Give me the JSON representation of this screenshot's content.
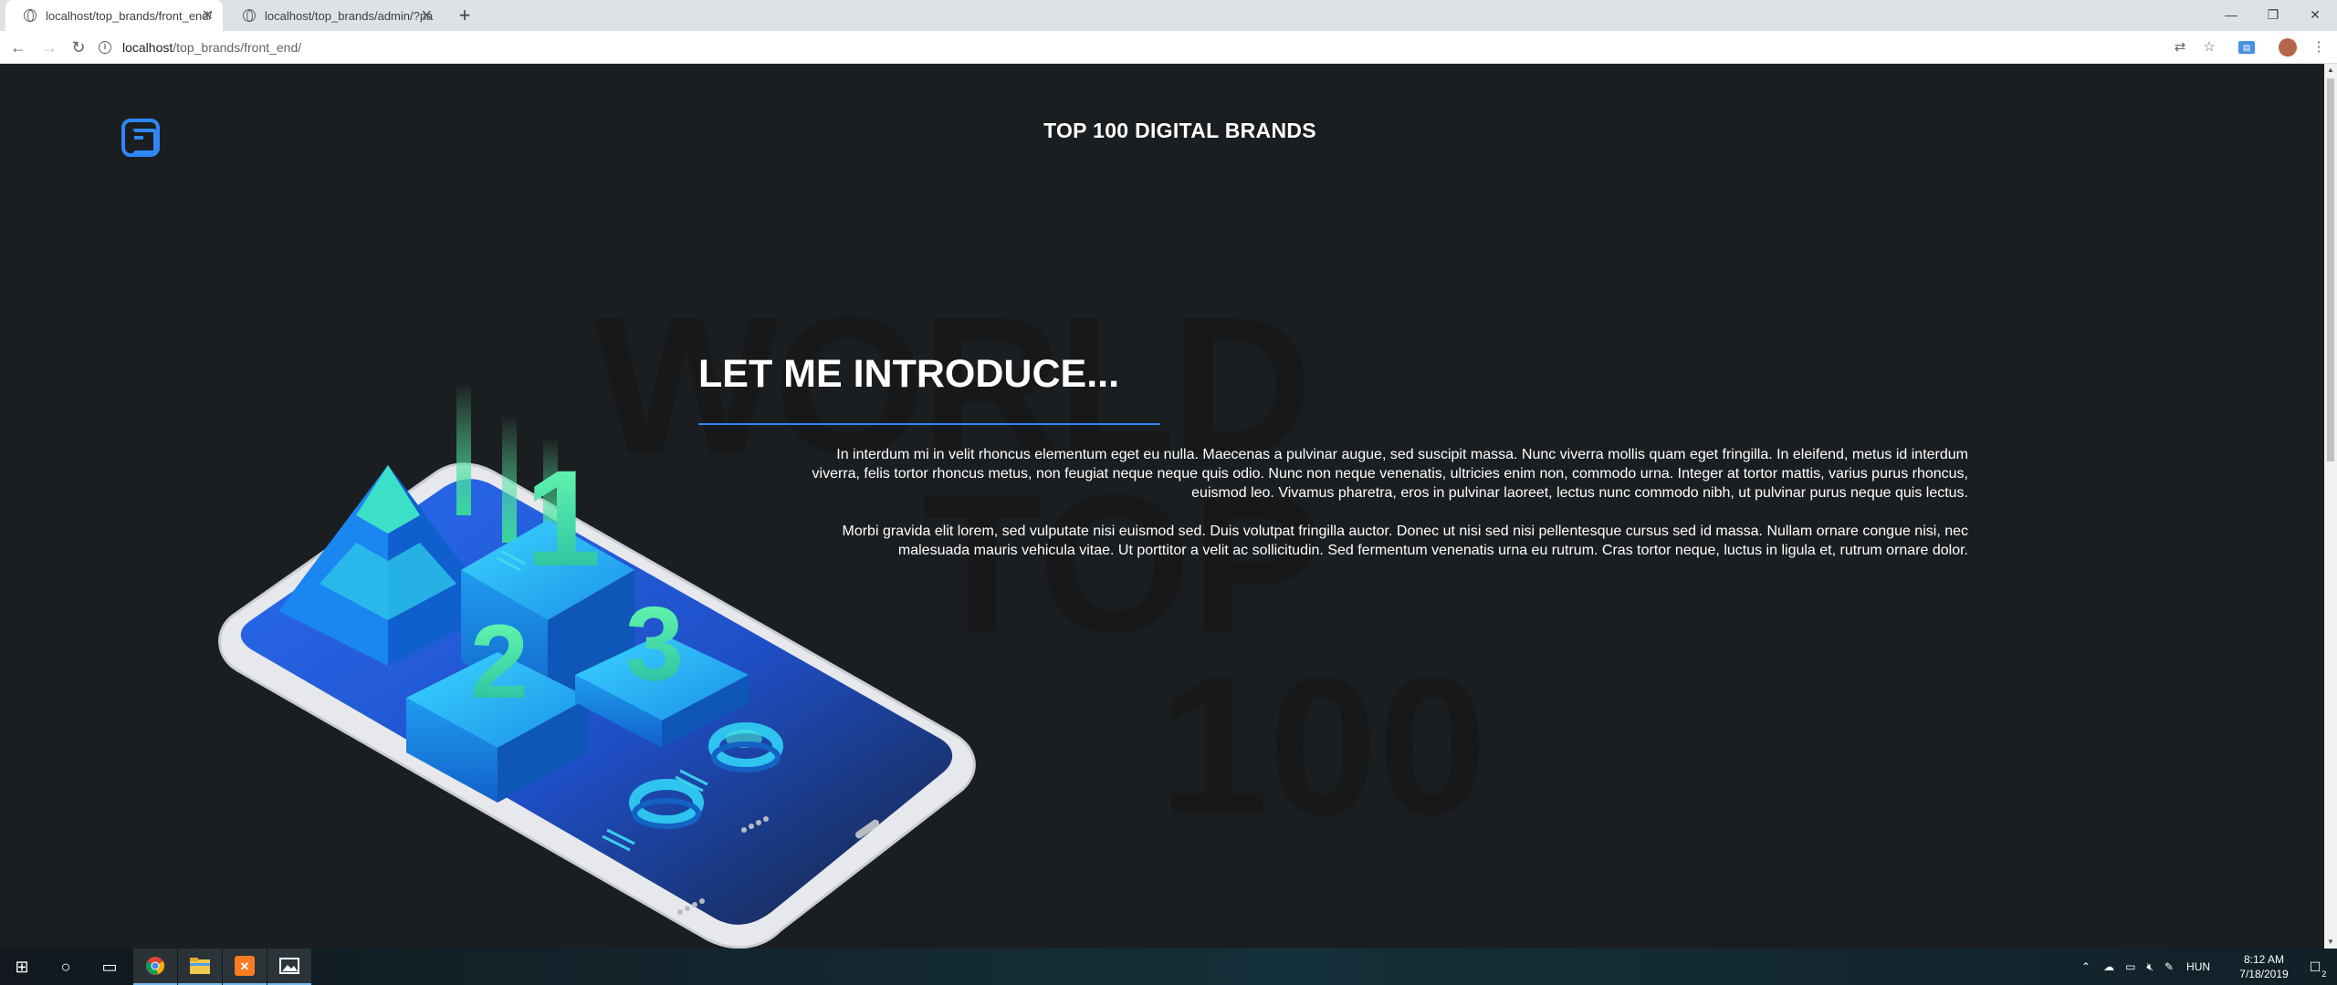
{
  "browser": {
    "tabs": [
      {
        "label": "localhost/top_brands/front_end/",
        "active": true
      },
      {
        "label": "localhost/top_brands/admin/?pa",
        "active": false
      }
    ],
    "new_tab": "+",
    "url_host": "localhost",
    "url_path": "/top_brands/front_end/"
  },
  "page": {
    "site_title": "TOP 100 DIGITAL BRANDS",
    "bg_words": [
      "WORLD",
      "TOP",
      "100"
    ],
    "heading": "LET ME INTRODUCE...",
    "paragraph1": "In interdum mi in velit rhoncus elementum eget eu nulla. Maecenas a pulvinar augue, sed suscipit massa. Nunc viverra mollis quam eget fringilla. In eleifend, metus id interdum viverra, felis tortor rhoncus metus, non feugiat neque neque quis odio. Nunc non neque venenatis, ultricies enim non, commodo urna. Integer at tortor mattis, varius purus rhoncus, euismod leo. Vivamus pharetra, eros in pulvinar laoreet, lectus nunc commodo nibh, ut pulvinar purus neque quis lectus.",
    "paragraph2": "Morbi gravida elit lorem, sed vulputate nisi euismod sed. Duis volutpat fringilla auctor. Donec ut nisi sed nisi pellentesque cursus sed id massa. Nullam ornare congue nisi, nec malesuada mauris vehicula vitae. Ut porttitor a velit ac sollicitudin. Sed fermentum venenatis urna eu rutrum. Cras tortor neque, luctus in ligula et, rutrum ornare dolor.",
    "illustration_numbers": [
      "1",
      "2",
      "3"
    ],
    "accent_color": "#2f86f6"
  },
  "taskbar": {
    "language": "HUN",
    "time": "8:12 AM",
    "date": "7/18/2019",
    "notification_count": "2"
  }
}
